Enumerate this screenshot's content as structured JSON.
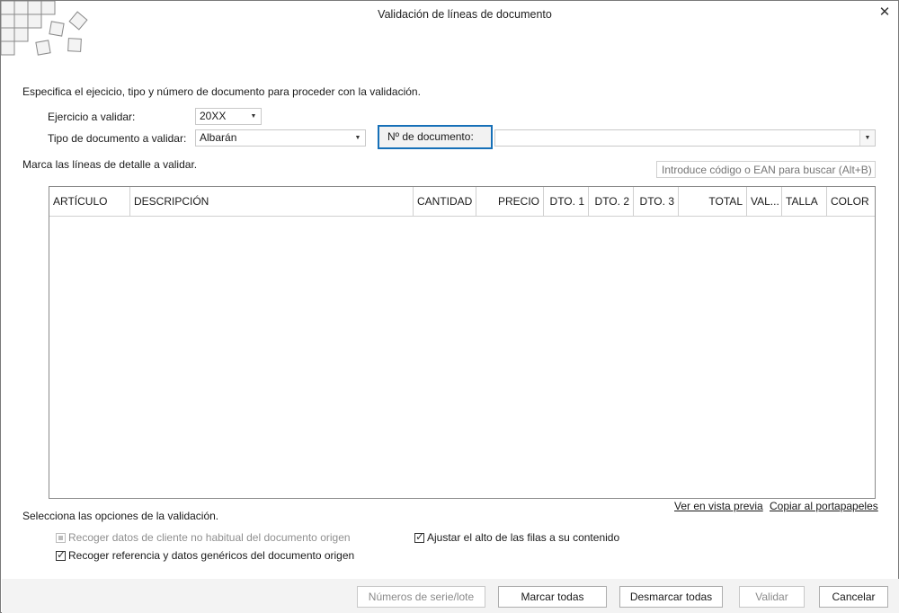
{
  "window": {
    "title": "Validación de líneas de documento",
    "close_icon": "close-x-icon",
    "logo_icon": "tiles-logo-icon"
  },
  "intro": "Especifica el ejecicio, tipo y número de documento para proceder con la validación.",
  "form": {
    "ejercicio_label": "Ejercicio a validar:",
    "ejercicio_value": "20XX",
    "tipo_label": "Tipo de documento a validar:",
    "tipo_value": "Albarán",
    "numero_button": "Nº de documento:",
    "numero_value": ""
  },
  "lines_label": "Marca las líneas de detalle a validar.",
  "search": {
    "placeholder": "Introduce código o EAN para buscar (Alt+B)",
    "value": ""
  },
  "grid": {
    "columns": [
      {
        "label": "ARTÍCULO",
        "align": "left"
      },
      {
        "label": "DESCRIPCIÓN",
        "align": "left"
      },
      {
        "label": "CANTIDAD",
        "align": "right"
      },
      {
        "label": "PRECIO",
        "align": "right"
      },
      {
        "label": "DTO. 1",
        "align": "right"
      },
      {
        "label": "DTO. 2",
        "align": "right"
      },
      {
        "label": "DTO. 3",
        "align": "right"
      },
      {
        "label": "TOTAL",
        "align": "right"
      },
      {
        "label": "VAL...",
        "align": "left"
      },
      {
        "label": "TALLA",
        "align": "left"
      },
      {
        "label": "COLOR",
        "align": "left"
      }
    ],
    "rows": []
  },
  "links": {
    "preview": "Ver en vista previa",
    "copy": "Copiar al portapapeles"
  },
  "options": {
    "title": "Selecciona las opciones de la validación.",
    "items": [
      {
        "label": "Recoger datos de cliente no habitual del documento origen",
        "checked": false,
        "disabled": true
      },
      {
        "label": "Recoger referencia y datos genéricos del documento origen",
        "checked": true,
        "disabled": false
      },
      {
        "label": "Ajustar el alto de las filas a su contenido",
        "checked": true,
        "disabled": false
      }
    ]
  },
  "buttons": {
    "serial": "Números de serie/lote",
    "mark_all": "Marcar todas",
    "unmark_all": "Desmarcar todas",
    "validate": "Validar",
    "cancel": "Cancelar"
  }
}
